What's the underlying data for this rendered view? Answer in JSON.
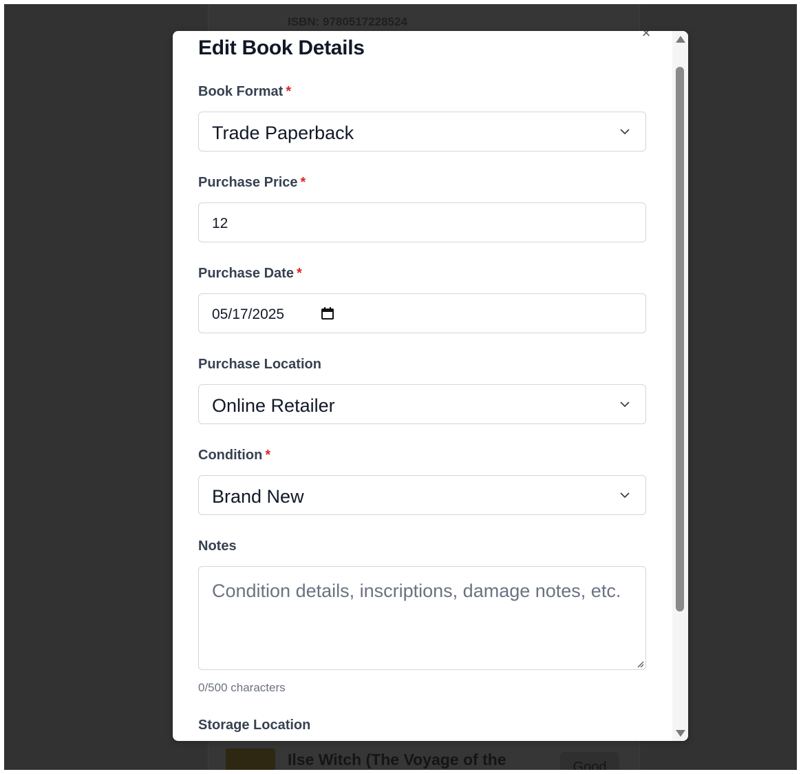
{
  "background": {
    "isbn": "ISBN: 9780517228524",
    "book_title": "Ilse Witch (The Voyage of the",
    "condition_badge": "Good"
  },
  "modal": {
    "title": "Edit Book Details",
    "close_glyph": "×",
    "fields": {
      "book_format": {
        "label": "Book Format",
        "required_mark": "*",
        "value": "Trade Paperback"
      },
      "purchase_price": {
        "label": "Purchase Price",
        "required_mark": "*",
        "value": "12"
      },
      "purchase_date": {
        "label": "Purchase Date",
        "required_mark": "*",
        "value": "05/17/2025"
      },
      "purchase_location": {
        "label": "Purchase Location",
        "value": "Online Retailer"
      },
      "condition": {
        "label": "Condition",
        "required_mark": "*",
        "value": "Brand New"
      },
      "notes": {
        "label": "Notes",
        "placeholder": "Condition details, inscriptions, damage notes, etc.",
        "char_count": "0/500 characters"
      },
      "storage_location": {
        "label": "Storage Location"
      }
    }
  },
  "icons": {
    "close": "close-icon",
    "chevron": "chevron-down-icon",
    "calendar": "calendar-icon"
  },
  "colors": {
    "required": "#dc2626",
    "overlay": "#323232",
    "label": "#374151"
  }
}
